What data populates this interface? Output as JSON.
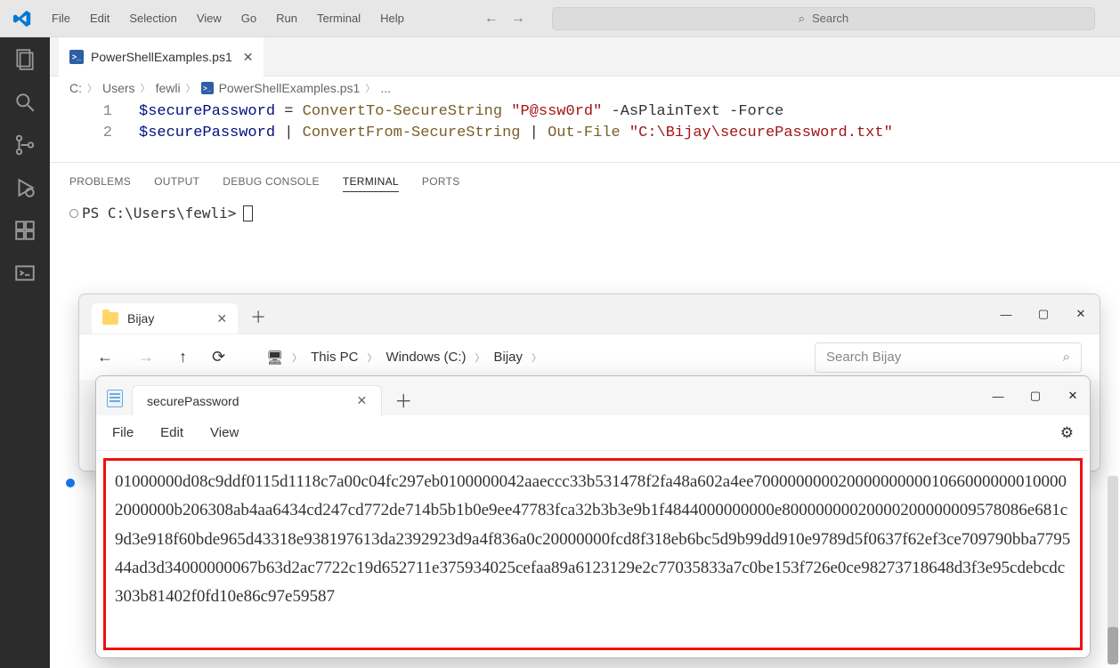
{
  "titlebar": {
    "menus": [
      "File",
      "Edit",
      "Selection",
      "View",
      "Go",
      "Run",
      "Terminal",
      "Help"
    ],
    "search_placeholder": "Search"
  },
  "tabs": {
    "file": "PowerShellExamples.ps1"
  },
  "breadcrumbs": {
    "c": "C:",
    "users": "Users",
    "user": "fewli",
    "file": "PowerShellExamples.ps1",
    "more": "..."
  },
  "code": {
    "line1": {
      "n": "1",
      "var": "$securePassword",
      "eq": " = ",
      "fn": "ConvertTo-SecureString",
      "sp": " ",
      "str": "\"P@ssw0rd\"",
      "flags": " -AsPlainText -Force"
    },
    "line2": {
      "n": "2",
      "var": "$securePassword",
      "pipe1": " | ",
      "fn1": "ConvertFrom-SecureString",
      "pipe2": " | ",
      "fn2": "Out-File",
      "sp": " ",
      "str": "\"C:\\Bijay\\securePassword.txt\""
    }
  },
  "panel": {
    "tabs": {
      "problems": "PROBLEMS",
      "output": "OUTPUT",
      "debug": "DEBUG CONSOLE",
      "terminal": "TERMINAL",
      "ports": "PORTS"
    },
    "prompt": "PS C:\\Users\\fewli> "
  },
  "explorer": {
    "tab": "Bijay",
    "path": {
      "pc": "This PC",
      "drive": "Windows (C:)",
      "folder": "Bijay"
    },
    "search": "Search Bijay"
  },
  "notepad": {
    "tab": "securePassword",
    "menus": {
      "file": "File",
      "edit": "Edit",
      "view": "View"
    },
    "content": "01000000d08c9ddf0115d1118c7a00c04fc297eb0100000042aaeccc33b531478f2fa48a602a4ee70000000002000000000010660000000100002000000b206308ab4aa6434cd247cd772de714b5b1b0e9ee47783fca32b3b3e9b1f4844000000000e80000000020000200000009578086e681c9d3e918f60bde965d43318e938197613da2392923d9a4f836a0c20000000fcd8f318eb6bc5d9b99dd910e9789d5f0637f62ef3ce709790bba779544ad3d34000000067b63d2ac7722c19d652711e375934025cefaa89a6123129e2c77035833a7c0be153f726e0ce98273718648d3f3e95cdebcdc303b81402f0fd10e86c97e59587"
  }
}
